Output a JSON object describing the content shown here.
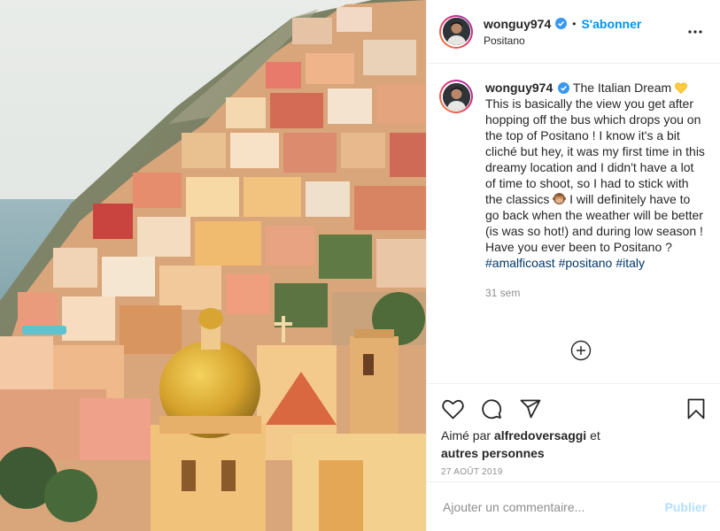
{
  "header": {
    "username": "wonguy974",
    "follow_label": "S'abonner",
    "location": "Positano",
    "dot": "•",
    "more_icon": "more-horizontal-icon"
  },
  "caption": {
    "username": "wonguy974",
    "title": "The Italian Dream",
    "text_1": "This is basically the view you get after hopping off the bus which drops you on the top of Positano ! I know it's a bit cliché but hey, it was my first time in this dreamy location and I didn't have a lot of time to shoot, so I had to stick with the classics",
    "text_2": "I will definitely have to go back when the weather will be better (is was so hot!) and during low season ! Have you ever been to Positano ?",
    "hashtags": [
      "#amalficoast",
      "#positano",
      "#italy"
    ],
    "age": "31 sem",
    "emoji_1": "yellow-heart-emoji",
    "emoji_2": "see-no-evil-monkey-emoji"
  },
  "actions": {
    "like_icon": "heart-icon",
    "comment_icon": "comment-icon",
    "share_icon": "share-icon",
    "save_icon": "bookmark-icon"
  },
  "likes": {
    "prefix": "Aimé par",
    "user": "alfredoversaggi",
    "connector": "et",
    "others": "autres personnes"
  },
  "date": "27 AOÛT 2019",
  "comment_box": {
    "placeholder": "Ajouter un commentaire...",
    "publish_label": "Publier"
  },
  "colors": {
    "accent": "#0095f6",
    "hashtag": "#00376b",
    "muted": "#8e8e8e",
    "publish_disabled": "#b2dffc"
  }
}
